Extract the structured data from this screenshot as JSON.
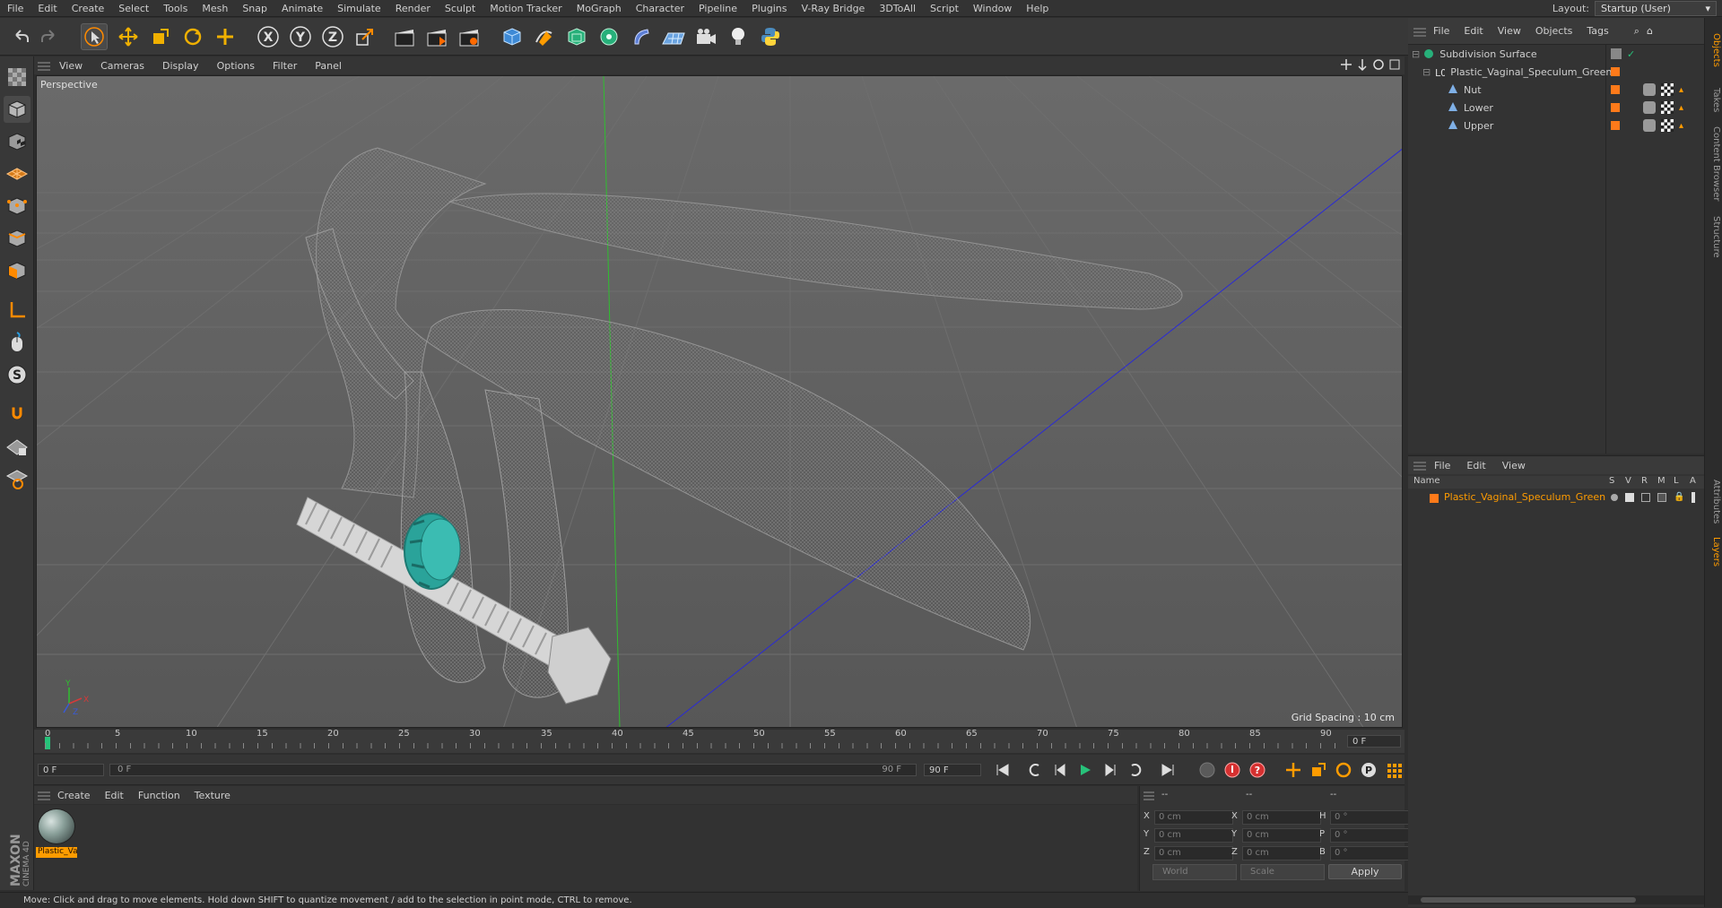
{
  "menubar": {
    "items": [
      "File",
      "Edit",
      "Create",
      "Select",
      "Tools",
      "Mesh",
      "Snap",
      "Animate",
      "Simulate",
      "Render",
      "Sculpt",
      "Motion Tracker",
      "MoGraph",
      "Character",
      "Pipeline",
      "Plugins",
      "V-Ray Bridge",
      "3DToAll",
      "Script",
      "Window",
      "Help"
    ],
    "layout_label": "Layout:",
    "layout_value": "Startup (User)"
  },
  "viewport": {
    "menu": [
      "View",
      "Cameras",
      "Display",
      "Options",
      "Filter",
      "Panel"
    ],
    "label": "Perspective",
    "grid_spacing": "Grid Spacing : 10 cm"
  },
  "timeline": {
    "ticks": [
      "0",
      "5",
      "10",
      "15",
      "20",
      "25",
      "30",
      "35",
      "40",
      "45",
      "50",
      "55",
      "60",
      "65",
      "70",
      "75",
      "80",
      "85",
      "90"
    ],
    "current_frame_right": "0 F"
  },
  "anim": {
    "start_frame": "0 F",
    "slider_left": "0 F",
    "slider_right": "90 F",
    "end_frame": "90 F"
  },
  "material": {
    "menu": [
      "Create",
      "Edit",
      "Function",
      "Texture"
    ],
    "name": "Plastic_Vaginal_Speculum_Green"
  },
  "coords": {
    "headers": [
      "--",
      "--",
      "--"
    ],
    "rows": [
      {
        "a": "X",
        "av": "0 cm",
        "b": "X",
        "bv": "0 cm",
        "c": "H",
        "cv": "0 °"
      },
      {
        "a": "Y",
        "av": "0 cm",
        "b": "Y",
        "bv": "0 cm",
        "c": "P",
        "cv": "0 °"
      },
      {
        "a": "Z",
        "av": "0 cm",
        "b": "Z",
        "bv": "0 cm",
        "c": "B",
        "cv": "0 °"
      }
    ],
    "mode": "World",
    "scale": "Scale",
    "apply": "Apply"
  },
  "object_manager": {
    "menu": [
      "File",
      "Edit",
      "View",
      "Objects",
      "Tags"
    ],
    "objects": [
      {
        "name": "Subdivision Surface",
        "level": 0
      },
      {
        "name": "Plastic_Vaginal_Speculum_Green",
        "level": 1
      },
      {
        "name": "Nut",
        "level": 2
      },
      {
        "name": "Lower",
        "level": 2
      },
      {
        "name": "Upper",
        "level": 2
      }
    ]
  },
  "layer_manager": {
    "menu": [
      "File",
      "Edit",
      "View"
    ],
    "columns": {
      "name": "Name",
      "s": "S",
      "v": "V",
      "r": "R",
      "m": "M",
      "l": "L",
      "a": "A"
    },
    "layer_name": "Plastic_Vaginal_Speculum_Green"
  },
  "side_tabs": [
    "Objects",
    "Takes",
    "Content Browser",
    "Structure",
    "Attributes",
    "Layers"
  ],
  "brand": "MAXON CINEMA 4D",
  "status_text": "Move: Click and drag to move elements. Hold down SHIFT to quantize movement / add to the selection in point mode, CTRL to remove.",
  "colors": {
    "accent": "#ff9c00",
    "selected_orange": "#ff8a00",
    "nut_teal": "#2aa39a",
    "axis_green": "#2fbf2f",
    "axis_blue": "#2a2ad6"
  }
}
